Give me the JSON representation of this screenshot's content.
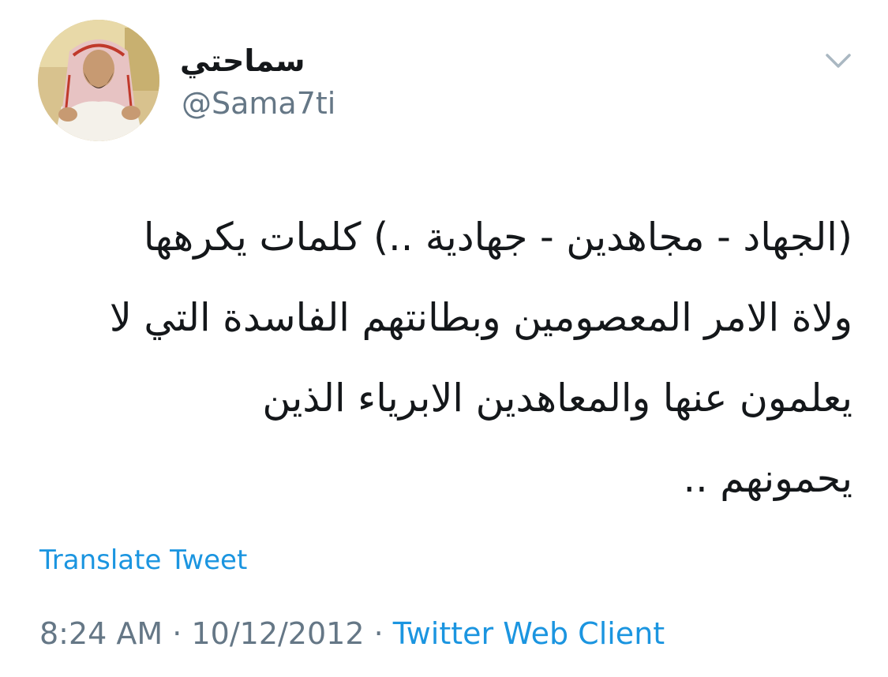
{
  "tweet": {
    "author": {
      "display_name": "سماحتي",
      "handle": "@Sama7ti"
    },
    "text": "(الجهاد - مجاهدين - جهادية ..) كلمات يكرهها\nولاة الامر المعصومين وبطانتهم الفاسدة التي لا\nيعلمون عنها والمعاهدين الابرياء الذين\nيحمونهم ..",
    "translate_label": "Translate Tweet",
    "time": "8:24 AM",
    "separator": "·",
    "date": "10/12/2012",
    "client": "Twitter Web Client"
  },
  "icons": {
    "menu": "chevron-down-icon",
    "avatar": "avatar"
  },
  "colors": {
    "link": "#1b95e0",
    "secondary_text": "#657786",
    "primary_text": "#14171a",
    "background": "#ffffff"
  }
}
